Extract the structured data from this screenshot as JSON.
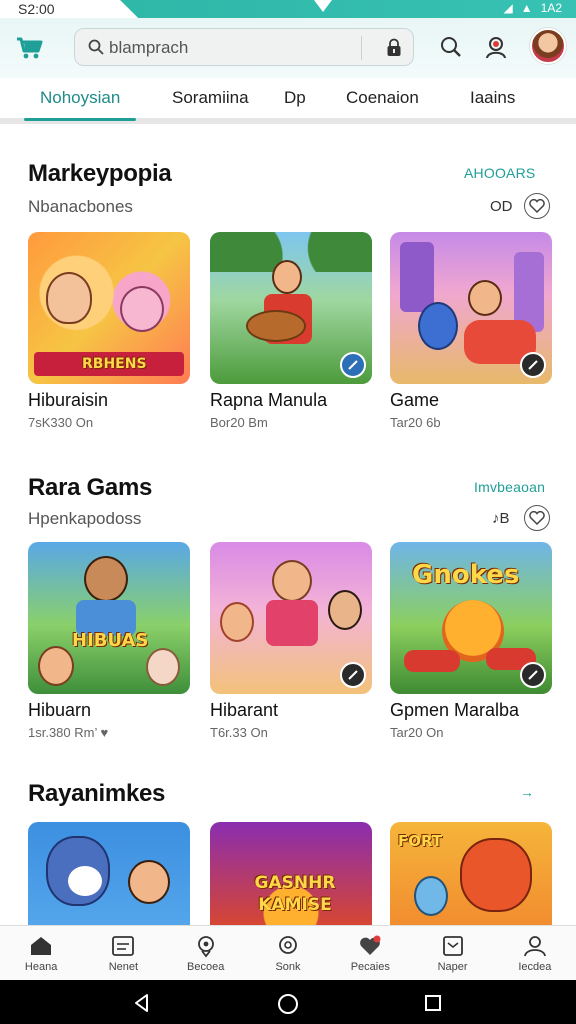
{
  "status_bar": {
    "time": "S2:00",
    "right_text": "1A2"
  },
  "search": {
    "placeholder": "blamprach"
  },
  "tabs": [
    {
      "label": "Nohoysian",
      "active": true
    },
    {
      "label": "Soramiina",
      "active": false
    },
    {
      "label": "Dp",
      "active": false
    },
    {
      "label": "Coenaion",
      "active": false
    },
    {
      "label": "Iaains",
      "active": false
    }
  ],
  "sections": [
    {
      "title": "Markeypopia",
      "subtitle": "Nbanacbones",
      "link": "AHOOARS",
      "meta": "OD",
      "cards": [
        {
          "name": "Hiburaisin",
          "meta": "7sK330 On",
          "thumb_text": "RBHENS",
          "badge": "play-icon"
        },
        {
          "name": "Rapna Manula",
          "meta": "Bor20 Bm",
          "thumb_text": "",
          "badge": "play-icon"
        },
        {
          "name": "Game",
          "meta": "Tar20 6b",
          "thumb_text": "",
          "badge": "play-icon"
        }
      ]
    },
    {
      "title": "Rara Gams",
      "subtitle": "Hpenkapodoss",
      "link": "Imvbeaoan",
      "meta": "♪B",
      "cards": [
        {
          "name": "Hibuarn",
          "meta": "1sr.380 Rm’ ♥",
          "thumb_text": "HIBUAS",
          "badge": ""
        },
        {
          "name": "Hibarant",
          "meta": "T6r.33 On",
          "thumb_text": "",
          "badge": "play-icon"
        },
        {
          "name": "Gpmen Maralba",
          "meta": "Tar20 On",
          "thumb_text": "Gnokes",
          "badge": "play-icon"
        }
      ]
    },
    {
      "title": "Rayanimkes",
      "link": "→",
      "cards": [
        {
          "name": "",
          "meta": "",
          "thumb_text": ""
        },
        {
          "name": "",
          "meta": "",
          "thumb_text": "GASNHR KAMISE"
        },
        {
          "name": "",
          "meta": "",
          "thumb_text": "FORT"
        }
      ]
    }
  ],
  "bottom_nav": [
    {
      "label": "Heana",
      "icon": "home-icon"
    },
    {
      "label": "Nenet",
      "icon": "news-icon"
    },
    {
      "label": "Becoea",
      "icon": "pin-icon"
    },
    {
      "label": "Sonk",
      "icon": "search-icon"
    },
    {
      "label": "Pecaies",
      "icon": "heart-icon"
    },
    {
      "label": "Naper",
      "icon": "library-icon"
    },
    {
      "label": "Iecdea",
      "icon": "profile-icon"
    }
  ],
  "colors": {
    "accent": "#1f9f98",
    "header_bg": "#e8f6f5"
  }
}
